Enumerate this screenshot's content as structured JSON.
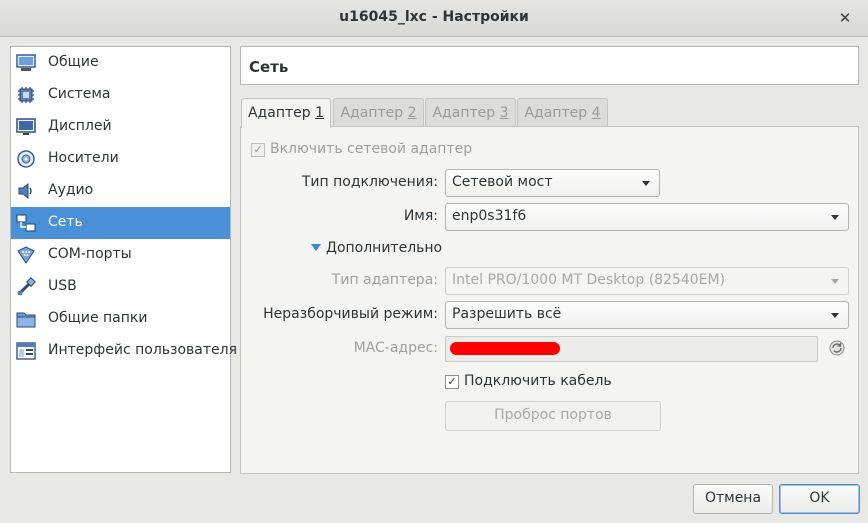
{
  "window": {
    "title": "u16045_lxc - Настройки",
    "close_glyph": "✕"
  },
  "sidebar": {
    "items": [
      {
        "label": "Общие",
        "icon": "general-icon"
      },
      {
        "label": "Система",
        "icon": "system-icon"
      },
      {
        "label": "Дисплей",
        "icon": "display-icon"
      },
      {
        "label": "Носители",
        "icon": "storage-icon"
      },
      {
        "label": "Аудио",
        "icon": "audio-icon"
      },
      {
        "label": "Сеть",
        "icon": "network-icon",
        "selected": true
      },
      {
        "label": "COM-порты",
        "icon": "serial-ports-icon"
      },
      {
        "label": "USB",
        "icon": "usb-icon"
      },
      {
        "label": "Общие папки",
        "icon": "shared-folders-icon"
      },
      {
        "label": "Интерфейс пользователя",
        "icon": "user-interface-icon"
      }
    ]
  },
  "section": {
    "title": "Сеть"
  },
  "tabs": [
    {
      "prefix": "Адаптер ",
      "mnemonic": "1",
      "active": true
    },
    {
      "prefix": "Адаптер ",
      "mnemonic": "2",
      "active": false
    },
    {
      "prefix": "Адаптер ",
      "mnemonic": "3",
      "active": false
    },
    {
      "prefix": "Адаптер ",
      "mnemonic": "4",
      "active": false
    }
  ],
  "adapter": {
    "enable_label": "Включить сетевой адаптер",
    "enable_checked": true,
    "attached_to_label": "Тип подключения:",
    "attached_to_value": "Сетевой мост",
    "name_label": "Имя:",
    "name_value": "enp0s31f6",
    "advanced_label": "Дополнительно",
    "adapter_type_label": "Тип адаптера:",
    "adapter_type_value": "Intel PRO/1000 MT Desktop (82540EM)",
    "promiscuous_label": "Неразборчивый режим:",
    "promiscuous_value": "Разрешить всё",
    "mac_label": "MAC-адрес:",
    "cable_label": "Подключить кабель",
    "cable_checked": true,
    "port_forwarding_label": "Проброс портов"
  },
  "buttons": {
    "cancel": "Отмена",
    "ok": "OK"
  },
  "colors": {
    "selection": "#4a90d9",
    "redaction": "#ff0000",
    "accent": "#3b85d4"
  }
}
